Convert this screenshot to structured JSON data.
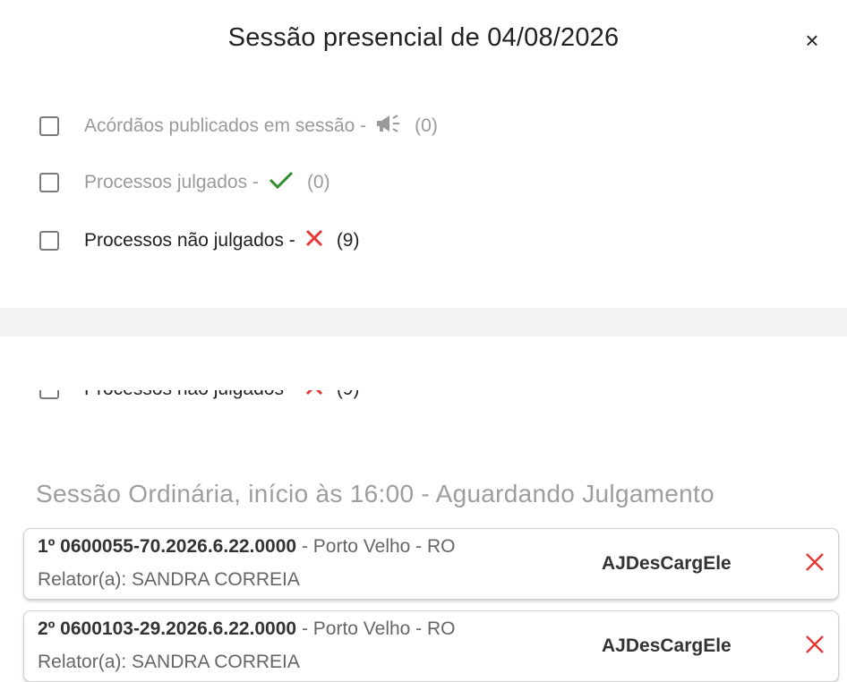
{
  "dialog": {
    "title": "Sessão presencial de 04/08/2026",
    "close_label": "×"
  },
  "filters": [
    {
      "label": "Acórdãos publicados em sessão -",
      "icon": "megaphone-icon",
      "count": "(0)",
      "muted": true
    },
    {
      "label": "Processos julgados -",
      "icon": "check-icon",
      "count": "(0)",
      "muted": true
    },
    {
      "label": "Processos não julgados -",
      "icon": "x-icon",
      "count": "(9)",
      "muted": false
    }
  ],
  "session": {
    "title": "Sessão Ordinária, início às 16:00 - Aguardando Julgamento",
    "items": [
      {
        "number": "1º 0600055-70.2026.6.22.0000",
        "location": " - Porto Velho - RO",
        "relator": "Relator(a): SANDRA CORREIA",
        "tag": "AJDesCargEle"
      },
      {
        "number": "2º 0600103-29.2026.6.22.0000",
        "location": " - Porto Velho - RO",
        "relator": "Relator(a): SANDRA CORREIA",
        "tag": "AJDesCargEle"
      }
    ]
  },
  "colors": {
    "check": "#2e8b2e",
    "x": "#e53935",
    "muted_text": "#9a9a9a"
  }
}
